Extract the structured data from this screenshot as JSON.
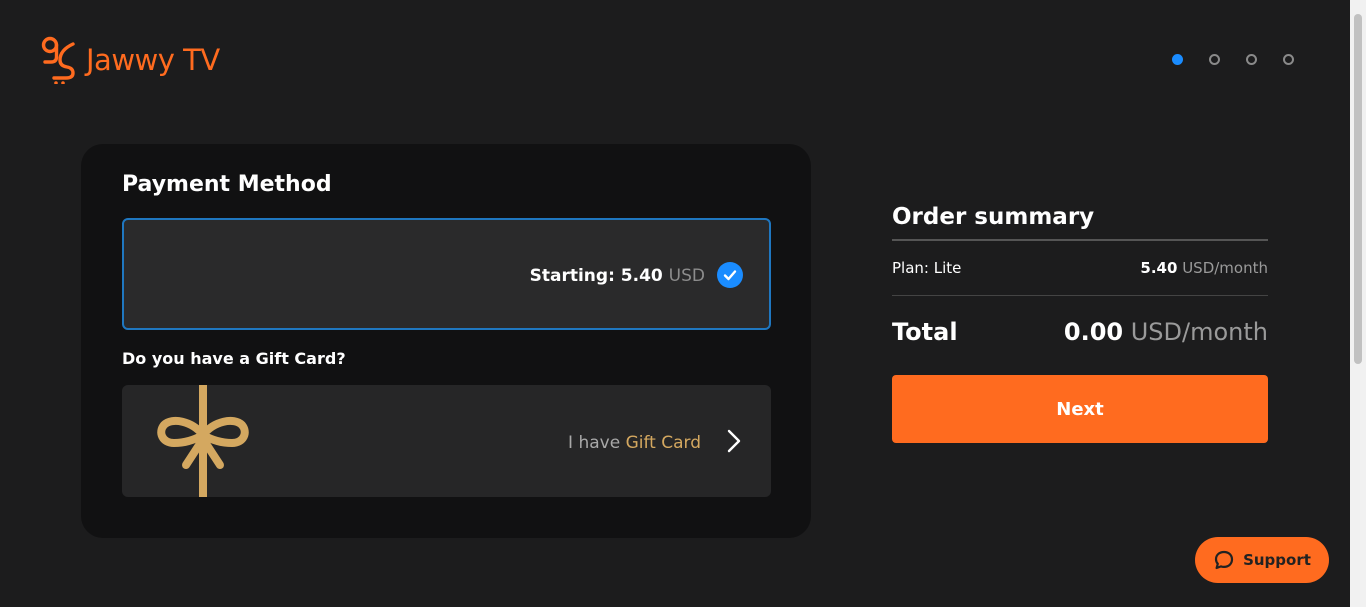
{
  "brand": {
    "name": "Jawwy TV",
    "color": "#ff6b1f",
    "logo_icon": "jawwy-logo-icon"
  },
  "steps": {
    "total": 4,
    "current": 1,
    "active_color": "#1a8cff"
  },
  "payment": {
    "title": "Payment Method",
    "method": {
      "starting_label": "Starting: 5.40",
      "currency": "USD",
      "selected": true,
      "icon": "check-circle-icon"
    }
  },
  "gift": {
    "question": "Do you have a Gift Card?",
    "prefix": "I have",
    "highlight": "Gift Card",
    "icon": "gift-ribbon-icon",
    "chevron_icon": "chevron-right-icon"
  },
  "summary": {
    "title": "Order summary",
    "plan_label": "Plan: Lite",
    "plan_price": "5.40",
    "plan_unit": "USD/month",
    "total_label": "Total",
    "total_price": "0.00",
    "total_unit": "USD/month",
    "next_label": "Next"
  },
  "support": {
    "label": "Support",
    "icon": "chat-bubble-icon"
  }
}
